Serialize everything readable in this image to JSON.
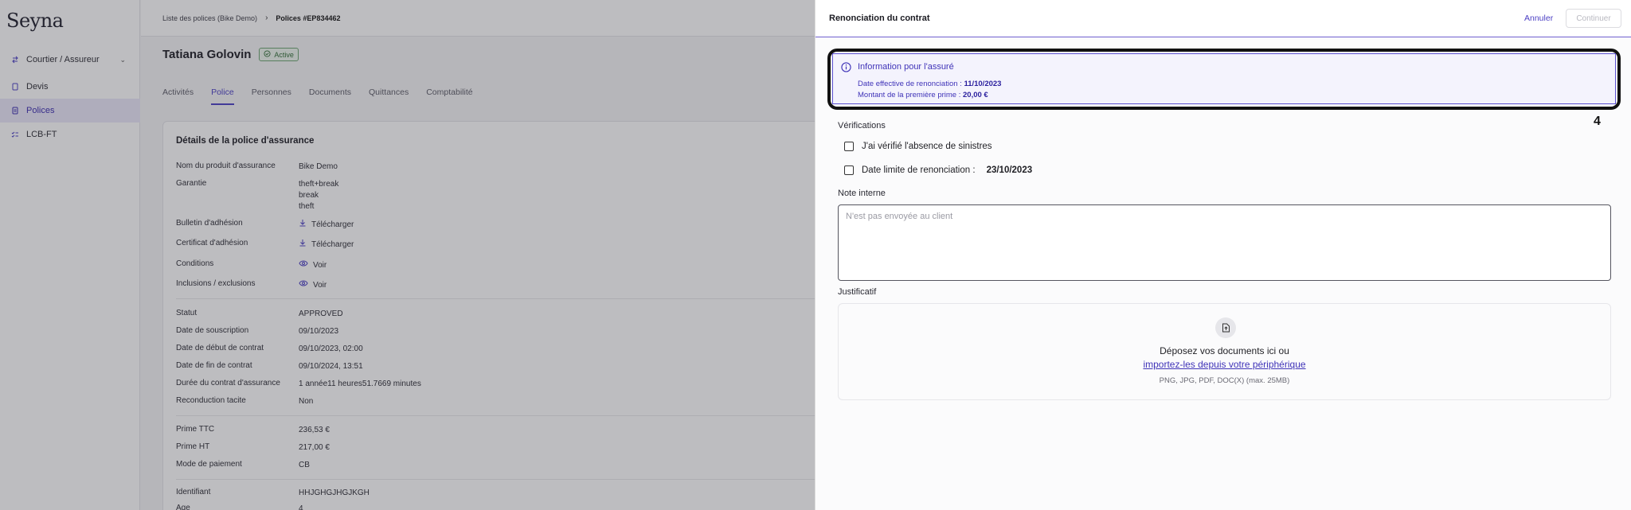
{
  "sidebar": {
    "logo": "Seyna",
    "items": [
      {
        "label": "Courtier / Assureur"
      },
      {
        "label": "Devis"
      },
      {
        "label": "Polices"
      },
      {
        "label": "LCB-FT"
      }
    ]
  },
  "breadcrumb": {
    "parent": "Liste des polices (Bike Demo)",
    "current": "Polices #EP834462"
  },
  "person": {
    "name": "Tatiana Golovin",
    "status": "Active"
  },
  "tabs": [
    "Activités",
    "Police",
    "Personnes",
    "Documents",
    "Quittances",
    "Comptabilité"
  ],
  "details": {
    "title": "Détails de la police d'assurance",
    "product_label": "Nom du produit d'assurance",
    "product_value": "Bike Demo",
    "garantie_label": "Garantie",
    "garantie_values": [
      "theft+break",
      "break",
      "theft"
    ],
    "bulletin_label": "Bulletin d'adhésion",
    "certificat_label": "Certificat d'adhésion",
    "download_label": "Télécharger",
    "conditions_label": "Conditions",
    "inclusions_label": "Inclusions / exclusions",
    "view_label": "Voir",
    "statut_label": "Statut",
    "statut_value": "APPROVED",
    "souscription_label": "Date de souscription",
    "souscription_value": "09/10/2023",
    "debut_label": "Date de début de contrat",
    "debut_value": "09/10/2023, 02:00",
    "fin_label": "Date de fin de contrat",
    "fin_value": "09/10/2024, 13:51",
    "duree_label": "Durée du contrat d'assurance",
    "duree_value": "1 année11 heures51.7669 minutes",
    "reconduction_label": "Reconduction tacite",
    "reconduction_value": "Non",
    "prime_ttc_label": "Prime TTC",
    "prime_ttc_value": "236,53 €",
    "prime_ht_label": "Prime HT",
    "prime_ht_value": "217,00 €",
    "paiement_label": "Mode de paiement",
    "paiement_value": "CB",
    "identifiant_label": "Identifiant",
    "identifiant_value": "HHJGHGJHGJKGH",
    "age_label": "Age",
    "age_value": "4"
  },
  "panel": {
    "title": "Renonciation du contrat",
    "cancel": "Annuler",
    "continue": "Continuer",
    "info": {
      "title": "Information pour l'assuré",
      "date_label": "Date effective de renonciation :",
      "date_value": "11/10/2023",
      "amount_label": "Montant de la première prime :",
      "amount_value": "20,00 €"
    },
    "marker": "4",
    "verifications_label": "Vérifications",
    "check_sinistres": "J'ai vérifié l'absence de sinistres",
    "check_date_label": "Date limite de renonciation :",
    "check_date_value": "23/10/2023",
    "note_label": "Note interne",
    "note_placeholder": "N'est pas envoyée au client",
    "justificatif_label": "Justificatif",
    "dropzone": {
      "text": "Déposez vos documents ici ou",
      "link": "importez-les depuis votre périphérique",
      "hint": "PNG, JPG, PDF, DOC(X) (max. 25MB)"
    }
  },
  "colors": {
    "accent": "#4b3fc4",
    "active_badge": "#2e6b34"
  }
}
